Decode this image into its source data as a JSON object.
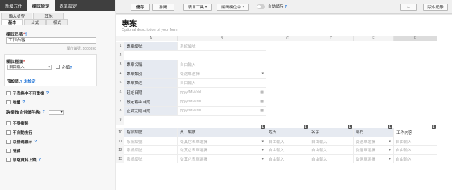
{
  "left_panel": {
    "top_tabs": [
      "新增元件",
      "欄位設定",
      "表單設定"
    ],
    "sub_tabs_row1": [
      "輸入檢查",
      "其他"
    ],
    "sub_tabs_row2": [
      "基本",
      "公式",
      "樣式"
    ],
    "field_name_label": "欄位名稱",
    "field_name_value": "工作內容",
    "field_id": "欄位編號: 1000398",
    "field_type_label": "欄位種類",
    "field_type_value": "自由輸入",
    "required_label": "必填",
    "default_value_label": "預設值",
    "default_value_value": "未設定",
    "options": [
      {
        "label": "子表格中不可重複"
      },
      {
        "label": "唯讀"
      },
      {
        "label": "跨欄數(合併儲存格)"
      },
      {
        "label": "不要複製"
      },
      {
        "label": "不自動換行"
      },
      {
        "label": "以條碼顯示"
      },
      {
        "label": "隱藏"
      },
      {
        "label": "忽略資料上鎖"
      }
    ],
    "help_mark": "?",
    "required_mark": "*",
    "colon": ":"
  },
  "toolbar": {
    "save": "儲存",
    "close": "離開",
    "form_tools": "表單工具",
    "edit_field": "編輯欄位中",
    "autosave": "自動儲存",
    "back": "←",
    "version": "版本紀錄"
  },
  "form": {
    "title": "專案",
    "description": "Optional description of your form",
    "columns": [
      "A",
      "B",
      "C",
      "D",
      "E",
      "F"
    ],
    "rows_top": [
      {
        "num": "1",
        "label": "專案編號",
        "value": "系統編號",
        "type": "text"
      },
      {
        "num": "2",
        "label": "",
        "value": "",
        "type": "blank"
      },
      {
        "num": "3",
        "label": "專案名稱",
        "value": "自由輸入",
        "type": "text"
      },
      {
        "num": "4",
        "label": "專案類別",
        "value": "從選單選擇",
        "type": "select"
      },
      {
        "num": "5",
        "label": "專案描述",
        "value": "自由輸入",
        "type": "text"
      },
      {
        "num": "6",
        "label": "起始日期",
        "value": "yyyy/MM/dd",
        "type": "date"
      },
      {
        "num": "7",
        "label": "預定截止日期",
        "value": "yyyy/MM/dd",
        "type": "date"
      },
      {
        "num": "8",
        "label": "正式完成日期",
        "value": "yyyy/MM/dd",
        "type": "date"
      },
      {
        "num": "9",
        "label": "",
        "value": "",
        "type": "blank"
      }
    ],
    "subtable_headers": [
      "指派編號",
      "員工編號",
      "姓氏",
      "名字",
      "部門",
      "工作內容"
    ],
    "subtable_badge": "L",
    "subtable_rows": [
      {
        "num": "11",
        "cells": [
          "系統編號",
          "從其它表單選擇",
          "自由輸入",
          "自由輸入",
          "從選單選擇",
          "自由輸入"
        ]
      },
      {
        "num": "12",
        "cells": [
          "系統編號",
          "從其它表單選擇",
          "自由輸入",
          "自由輸入",
          "從選單選擇",
          "自由輸入"
        ]
      },
      {
        "num": "13",
        "cells": [
          "系統編號",
          "從其它表單選擇",
          "自由輸入",
          "自由輸入",
          "從選單選擇",
          "自由輸入"
        ]
      }
    ],
    "header_row_num": "10"
  }
}
